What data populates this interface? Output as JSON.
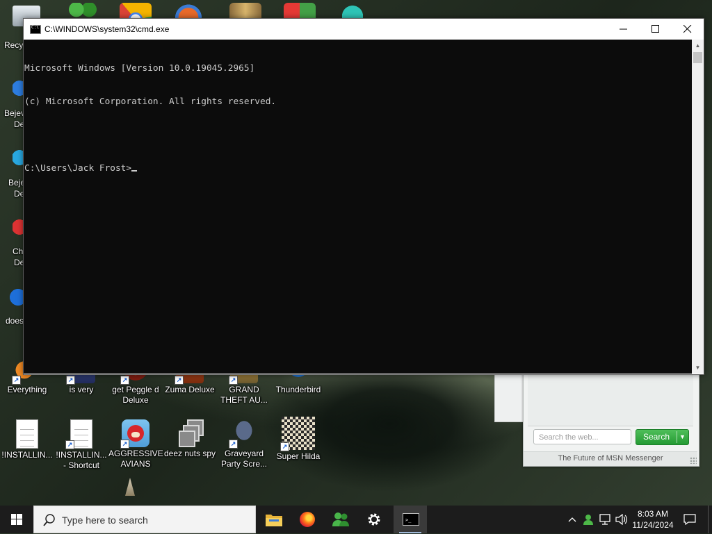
{
  "desktop": {
    "left_partial_labels": [
      "Recy",
      "Bejev",
      "De",
      "Beje",
      "De",
      "Ch",
      "De",
      "does"
    ],
    "icons_row1": [
      {
        "label": "Everything"
      },
      {
        "label": "is very"
      },
      {
        "label": "get Peggle d Deluxe"
      },
      {
        "label": "Zuma Deluxe"
      },
      {
        "label": "GRAND THEFT AU..."
      },
      {
        "label": "Thunderbird"
      }
    ],
    "icons_row2": [
      {
        "label": "!INSTALLIN..."
      },
      {
        "label": "!INSTALLIN... - Shortcut"
      },
      {
        "label": "AGGRESSIVE AVIANS"
      },
      {
        "label": "deez nuts spy"
      },
      {
        "label": "Graveyard Party Scre..."
      },
      {
        "label": "Super Hilda"
      }
    ]
  },
  "msn_widget": {
    "search_placeholder": "Search the web...",
    "search_button": "Search",
    "footer": "The Future of MSN Messenger"
  },
  "cmd_window": {
    "title": "C:\\WINDOWS\\system32\\cmd.exe",
    "lines": [
      "Microsoft Windows [Version 10.0.19045.2965]",
      "(c) Microsoft Corporation. All rights reserved.",
      "",
      "C:\\Users\\Jack Frost>"
    ]
  },
  "taskbar": {
    "search_placeholder": "Type here to search",
    "pinned_apps": [
      "file-explorer-icon",
      "firefox-icon",
      "msn-messenger-icon",
      "settings-icon",
      "command-prompt-icon"
    ],
    "clock_time": "8:03 AM",
    "clock_date": "11/24/2024"
  }
}
